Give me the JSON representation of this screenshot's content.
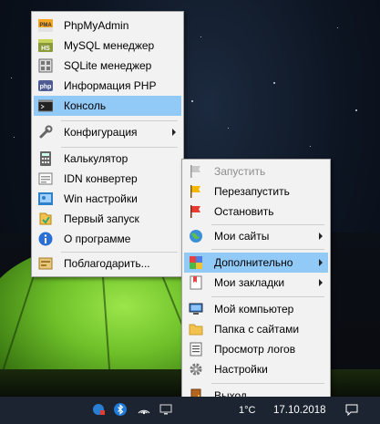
{
  "menu_main": {
    "items": [
      {
        "label": "PhpMyAdmin",
        "icon": "pma-icon"
      },
      {
        "label": "MySQL менеджер",
        "icon": "mysql-manager-icon"
      },
      {
        "label": "SQLite менеджер",
        "icon": "sqlite-manager-icon"
      },
      {
        "label": "Информация PHP",
        "icon": "php-icon"
      },
      {
        "label": "Консоль",
        "icon": "console-icon",
        "highlighted": true
      },
      {
        "label": "Конфигурация",
        "icon": "wrench-icon",
        "submenu": true
      },
      {
        "label": "Калькулятор",
        "icon": "calculator-icon"
      },
      {
        "label": "IDN конвертер",
        "icon": "idn-converter-icon"
      },
      {
        "label": "Win настройки",
        "icon": "win-settings-icon"
      },
      {
        "label": "Первый запуск",
        "icon": "first-launch-icon"
      },
      {
        "label": "О программе",
        "icon": "info-icon"
      },
      {
        "label": "Поблагодарить...",
        "icon": "thanks-icon"
      }
    ],
    "icon_text": {
      "pma": "PMA",
      "hs": "HS",
      "php": "php"
    }
  },
  "menu_tray": {
    "items": [
      {
        "label": "Запустить",
        "icon": "start-flag-icon",
        "disabled": true
      },
      {
        "label": "Перезапустить",
        "icon": "restart-flag-icon"
      },
      {
        "label": "Остановить",
        "icon": "stop-flag-icon"
      },
      {
        "label": "Мои сайты",
        "icon": "globe-icon",
        "submenu": true
      },
      {
        "label": "Дополнительно",
        "icon": "extras-icon",
        "submenu": true,
        "highlighted": true
      },
      {
        "label": "Мои закладки",
        "icon": "bookmarks-icon",
        "submenu": true
      },
      {
        "label": "Мой компьютер",
        "icon": "computer-icon"
      },
      {
        "label": "Папка с сайтами",
        "icon": "folder-icon"
      },
      {
        "label": "Просмотр логов",
        "icon": "logs-icon"
      },
      {
        "label": "Настройки",
        "icon": "gear-icon"
      },
      {
        "label": "Выход",
        "icon": "exit-door-icon"
      }
    ]
  },
  "taskbar": {
    "date": "17.10.2018",
    "temp": "1°C"
  },
  "colors": {
    "highlight": "#91c9f7",
    "menu_bg": "#f2f2f2",
    "taskbar": "#1b2430"
  }
}
